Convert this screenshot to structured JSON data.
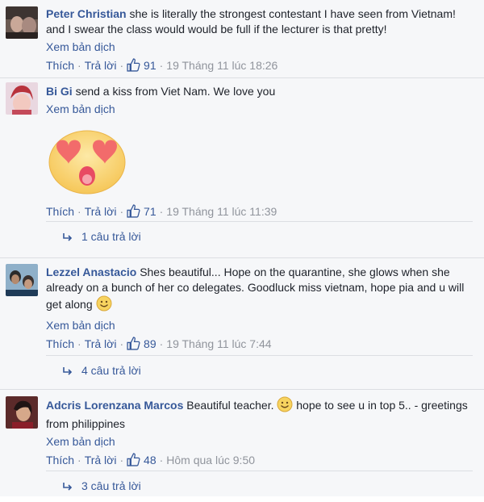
{
  "labels": {
    "see_translation": "Xem bản dịch",
    "like": "Thích",
    "reply": "Trả lời",
    "sep": "·"
  },
  "comments": [
    {
      "author": "Peter Christian",
      "text": "she is literally the strongest contestant I have seen from Vietnam! and I swear the class would would be full if the lecturer is that pretty!",
      "likes": "91",
      "time": "19 Tháng 11 lúc 18:26"
    },
    {
      "author": "Bi Gi",
      "text": "send a kiss from Viet Nam. We love you",
      "sticker": "heart-eyes-emoji",
      "likes": "71",
      "time": "19 Tháng 11 lúc 11:39",
      "replies": "1 câu trả lời"
    },
    {
      "author": "Lezzel Anastacio",
      "text": "Shes beautiful... Hope on the quarantine, she glows when she already on a bunch of her co delegates. Goodluck miss vietnam, hope pia and u will get along",
      "likes": "89",
      "time": "19 Tháng 11 lúc 7:44",
      "replies": "4 câu trả lời"
    },
    {
      "author": "Adcris Lorenzana Marcos",
      "text_before": "Beautiful teacher.",
      "text_after": "hope to see u in top 5.. - greetings from philippines",
      "likes": "48",
      "time": "Hôm qua lúc 9:50",
      "replies": "3 câu trả lời"
    }
  ],
  "colors": {
    "link": "#365899",
    "meta": "#90949c",
    "background": "#f6f7f9",
    "divider": "#dcdee3"
  }
}
